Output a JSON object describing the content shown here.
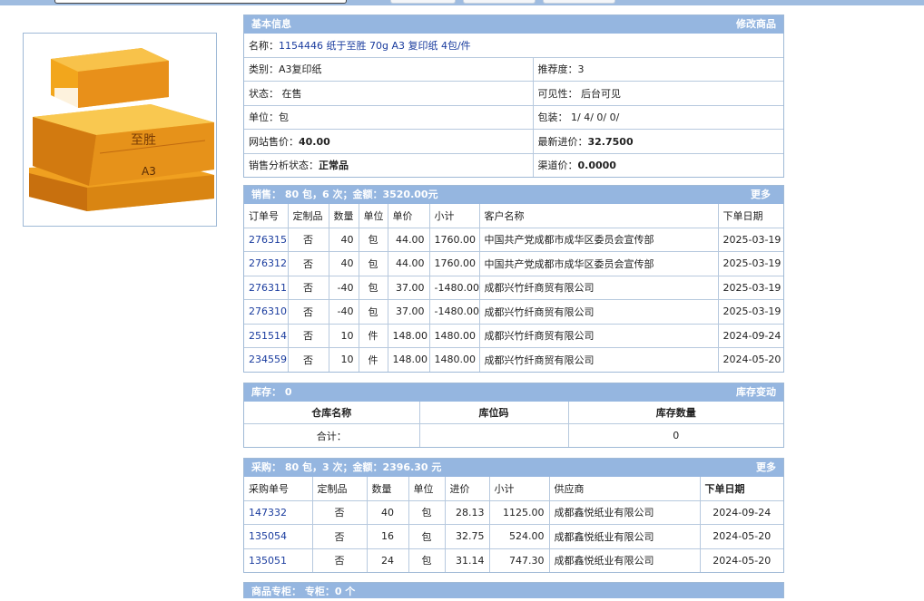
{
  "basic": {
    "header": "基本信息",
    "edit_link": "修改商品",
    "name_label": "名称：",
    "name_value": "1154446 纸于至胜 70g A3 复印纸 4包/件",
    "category_label": "类别：",
    "category_value": "A3复印纸",
    "recommend_label": "推荐度：",
    "recommend_value": "3",
    "status_label": "状态：",
    "status_value": "在售",
    "visibility_label": "可见性：",
    "visibility_value": "后台可见",
    "unit_label": "单位：",
    "unit_value": "包",
    "packing_label": "包装：",
    "packing_value": "1/ 4/ 0/ 0/",
    "web_price_label": "网站售价：",
    "web_price_value": "40.00",
    "latest_cost_label": "最新进价：",
    "latest_cost_value": "32.7500",
    "analysis_label": "销售分析状态：",
    "analysis_value": "正常品",
    "channel_price_label": "渠道价：",
    "channel_price_value": "0.0000"
  },
  "sales": {
    "header": "销售：  80 包，6 次；金额：3520.00元",
    "more_link": "更多",
    "columns": [
      "订单号",
      "定制品",
      "数量",
      "单位",
      "单价",
      "小计",
      "客户名称",
      "下单日期"
    ],
    "rows": [
      {
        "order": "276315",
        "custom": "否",
        "qty": "40",
        "unit": "包",
        "price": "44.00",
        "subtotal": "1760.00",
        "customer": "中国共产党成都市成华区委员会宣传部",
        "date": "2025-03-19"
      },
      {
        "order": "276312",
        "custom": "否",
        "qty": "40",
        "unit": "包",
        "price": "44.00",
        "subtotal": "1760.00",
        "customer": "中国共产党成都市成华区委员会宣传部",
        "date": "2025-03-19"
      },
      {
        "order": "276311",
        "custom": "否",
        "qty": "-40",
        "unit": "包",
        "price": "37.00",
        "subtotal": "-1480.00",
        "customer": "成都兴竹纤商贸有限公司",
        "date": "2025-03-19"
      },
      {
        "order": "276310",
        "custom": "否",
        "qty": "-40",
        "unit": "包",
        "price": "37.00",
        "subtotal": "-1480.00",
        "customer": "成都兴竹纤商贸有限公司",
        "date": "2025-03-19"
      },
      {
        "order": "251514",
        "custom": "否",
        "qty": "10",
        "unit": "件",
        "price": "148.00",
        "subtotal": "1480.00",
        "customer": "成都兴竹纤商贸有限公司",
        "date": "2024-09-24"
      },
      {
        "order": "234559",
        "custom": "否",
        "qty": "10",
        "unit": "件",
        "price": "148.00",
        "subtotal": "1480.00",
        "customer": "成都兴竹纤商贸有限公司",
        "date": "2024-05-20"
      }
    ]
  },
  "stock": {
    "header": "库存：  0",
    "change_link": "库存变动",
    "columns": [
      "仓库名称",
      "库位码",
      "库存数量"
    ],
    "total_label": "合计：",
    "total_location": "",
    "total_qty": "0"
  },
  "purchase": {
    "header": "采购：  80 包，3 次；金额：2396.30 元",
    "more_link": "更多",
    "columns": [
      "采购单号",
      "定制品",
      "数量",
      "单位",
      "进价",
      "小计",
      "供应商",
      "下单日期"
    ],
    "rows": [
      {
        "order": "147332",
        "custom": "否",
        "qty": "40",
        "unit": "包",
        "price": "28.13",
        "subtotal": "1125.00",
        "supplier": "成都鑫悦纸业有限公司",
        "date": "2024-09-24"
      },
      {
        "order": "135054",
        "custom": "否",
        "qty": "16",
        "unit": "包",
        "price": "32.75",
        "subtotal": "524.00",
        "supplier": "成都鑫悦纸业有限公司",
        "date": "2024-05-20"
      },
      {
        "order": "135051",
        "custom": "否",
        "qty": "24",
        "unit": "包",
        "price": "31.14",
        "subtotal": "747.30",
        "supplier": "成都鑫悦纸业有限公司",
        "date": "2024-05-20"
      }
    ]
  },
  "cabinet": {
    "header": "商品专柜：  专柜：0 个"
  },
  "colors": {
    "header_bg": "#95b6e0",
    "border": "#9fb9d6",
    "link": "#1a3c9e",
    "box_orange": "#f0a020"
  }
}
